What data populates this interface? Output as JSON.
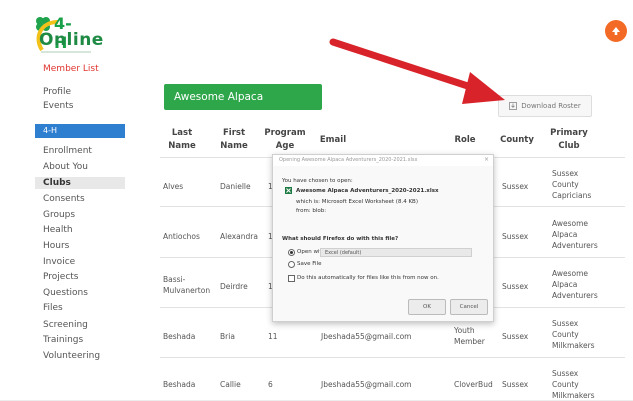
{
  "logo": {
    "brand_line1": "4-H",
    "brand_line2": "Online"
  },
  "sidebar": {
    "member_list": "Member List",
    "profile": "Profile",
    "events": "Events",
    "section": "4-H",
    "items": [
      "Enrollment",
      "About You",
      "Clubs",
      "Consents",
      "Groups",
      "Health",
      "Hours",
      "Invoice",
      "Projects",
      "Questions",
      "Files",
      "Screening",
      "Trainings",
      "Volunteering"
    ]
  },
  "club": {
    "title": "Awesome Alpaca Adventurers"
  },
  "download_roster": "Download Roster",
  "table": {
    "headers": {
      "last_name": [
        "Last",
        "Name"
      ],
      "first_name": [
        "First",
        "Name"
      ],
      "program_age": [
        "Program",
        "Age"
      ],
      "email": "Email",
      "role": "Role",
      "county": "County",
      "primary_club": [
        "Primary",
        "Club"
      ]
    },
    "rows": [
      {
        "last": "Alves",
        "first": "Danielle",
        "age": "1",
        "email": "",
        "role": "",
        "county": "Sussex",
        "club": [
          "Sussex",
          "County",
          "Capricians"
        ]
      },
      {
        "last": "Antiochos",
        "first": "Alexandra",
        "age": "1",
        "email": "",
        "role": "",
        "county": "Sussex",
        "club": [
          "Awesome",
          "Alpaca",
          "Adventurers"
        ]
      },
      {
        "last": [
          "Bassi-",
          "Mulvanerton"
        ],
        "first": "Deirdre",
        "age": "1",
        "email": "",
        "role": "",
        "county": "Sussex",
        "club": [
          "Awesome",
          "Alpaca",
          "Adventurers"
        ]
      },
      {
        "last": "Beshada",
        "first": "Bria",
        "age": "11",
        "email": "Jbeshada55@gmail.com",
        "role": [
          "Youth",
          "Member"
        ],
        "county": "Sussex",
        "club": [
          "Sussex",
          "County",
          "Milkmakers"
        ]
      },
      {
        "last": "Beshada",
        "first": "Callie",
        "age": "6",
        "email": "Jbeshada55@gmail.com",
        "role": "CloverBud",
        "county": "Sussex",
        "club": [
          "Sussex",
          "County",
          "Milkmakers"
        ]
      }
    ]
  },
  "dialog": {
    "title": "Opening Awesome Alpaca Adventurers_2020-2021.xlsx",
    "close": "×",
    "you_chosen": "You have chosen to open:",
    "file_name": "Awesome Alpaca Adventurers_2020-2021.xlsx",
    "which_is": "which is:  Microsoft Excel Worksheet (8.4 KB)",
    "from": "from:  blob:",
    "question": "What should Firefox do with this file?",
    "open_with": "Open with",
    "open_with_app": "Excel (default)",
    "save_file": "Save File",
    "auto": "Do this automatically for files like this from now on.",
    "ok": "OK",
    "cancel": "Cancel"
  },
  "colors": {
    "green": "#2ea64a",
    "blue": "#2f7fd1",
    "red_arrow": "#d9232a",
    "orange": "#f26a25"
  }
}
